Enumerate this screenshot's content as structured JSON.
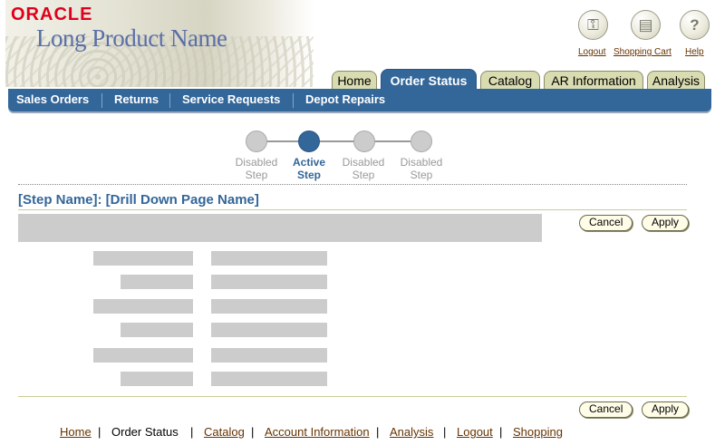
{
  "branding": {
    "brand": "ORACLE",
    "product": "Long Product Name"
  },
  "global_links": [
    {
      "label": "Logout",
      "icon": "key-icon"
    },
    {
      "label": "Shopping Cart",
      "icon": "cart-icon"
    },
    {
      "label": "Help",
      "icon": "help-icon"
    }
  ],
  "tabs": [
    {
      "label": "Home"
    },
    {
      "label": "Order Status",
      "active": true
    },
    {
      "label": "Catalog"
    },
    {
      "label": "AR Information"
    },
    {
      "label": "Analysis"
    }
  ],
  "subtabs": [
    "Sales Orders",
    "Returns",
    "Service Requests",
    "Depot Repairs"
  ],
  "train": [
    {
      "line1": "Disabled",
      "line2": "Step"
    },
    {
      "line1": "Active",
      "line2": "Step",
      "active": true
    },
    {
      "line1": "Disabled",
      "line2": "Step"
    },
    {
      "line1": "Disabled",
      "line2": "Step"
    }
  ],
  "page": {
    "title": "[Step Name]: [Drill Down Page Name]"
  },
  "buttons": {
    "cancel": "Cancel",
    "apply": "Apply"
  },
  "footer": [
    {
      "label": "Home",
      "link": true
    },
    {
      "label": "Order Status",
      "link": false
    },
    {
      "label": "Catalog",
      "link": true
    },
    {
      "label": "Account Information",
      "link": true
    },
    {
      "label": "Analysis",
      "link": true
    },
    {
      "label": "Logout",
      "link": true
    },
    {
      "label": "Shopping",
      "link": true
    }
  ],
  "colors": {
    "brand_red": "#e0001b",
    "blue": "#336699",
    "tab_beige": "#d9dbb0",
    "link": "#663300"
  }
}
